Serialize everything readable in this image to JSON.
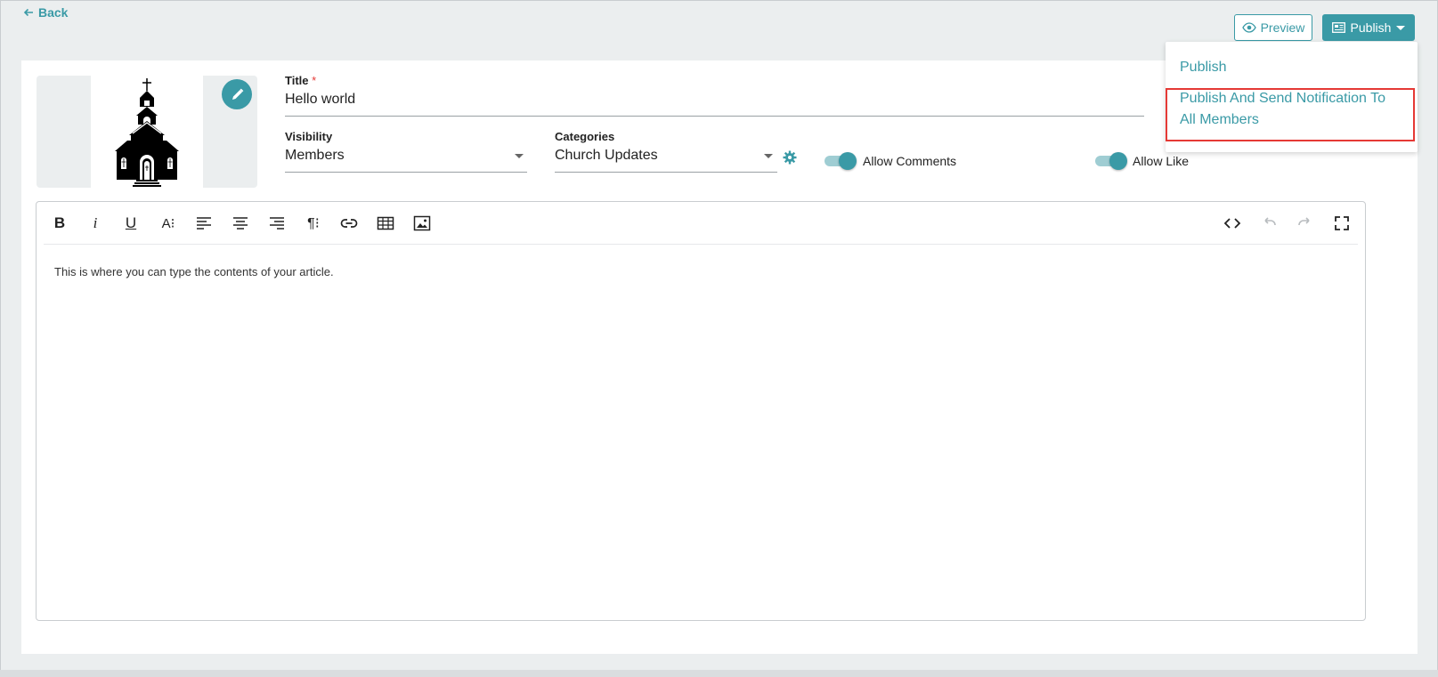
{
  "header": {
    "back_label": "Back",
    "preview_label": "Preview",
    "publish_label": "Publish"
  },
  "publish_menu": {
    "items": [
      {
        "label": "Publish"
      },
      {
        "label": "Publish And Send Notification To All Members"
      }
    ]
  },
  "form": {
    "title_label": "Title",
    "title_required_mark": "*",
    "title_value": "Hello world",
    "visibility_label": "Visibility",
    "visibility_value": "Members",
    "categories_label": "Categories",
    "categories_value": "Church Updates",
    "allow_comments_label": "Allow Comments",
    "allow_comments_on": true,
    "allow_like_label": "Allow Like",
    "allow_like_on": true
  },
  "editor": {
    "placeholder_text": "This is where you can type the contents of your article.",
    "toolbar": {
      "bold": "B",
      "italic": "i",
      "underline": "U",
      "font_size": "A⁝",
      "paragraph": "¶⁝"
    }
  },
  "colors": {
    "accent": "#3a9aa6",
    "highlight_border": "#e53935",
    "background": "#ebeeef"
  }
}
